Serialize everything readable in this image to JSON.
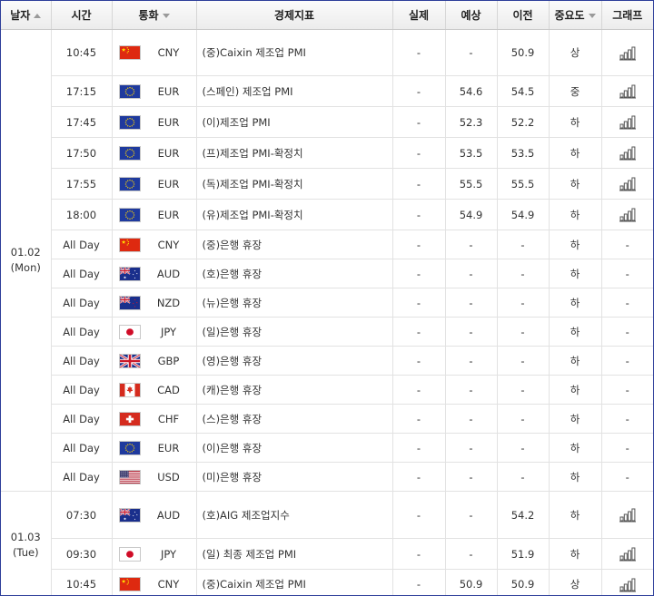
{
  "headers": [
    {
      "key": "date",
      "label": "날자",
      "sort": "up"
    },
    {
      "key": "time",
      "label": "시간",
      "sort": null
    },
    {
      "key": "currency",
      "label": "통화",
      "sort": "down"
    },
    {
      "key": "indicator",
      "label": "경제지표",
      "sort": null
    },
    {
      "key": "actual",
      "label": "실제",
      "sort": null
    },
    {
      "key": "forecast",
      "label": "예상",
      "sort": null
    },
    {
      "key": "previous",
      "label": "이전",
      "sort": null
    },
    {
      "key": "importance",
      "label": "중요도",
      "sort": "down"
    },
    {
      "key": "graph",
      "label": "그래프",
      "sort": null
    }
  ],
  "date_groups": [
    {
      "date": "01.02",
      "day": "(Mon)",
      "rows": [
        {
          "time": "10:45",
          "flag": "cn-flag-icon",
          "currency": "CNY",
          "indicator": "(중)Caixin 제조업 PMI",
          "actual": "-",
          "forecast": "-",
          "previous": "50.9",
          "importance": "상",
          "graph": true
        },
        {
          "time": "17:15",
          "flag": "eu-flag-icon",
          "currency": "EUR",
          "indicator": "(스페인) 제조업 PMI",
          "actual": "-",
          "forecast": "54.6",
          "previous": "54.5",
          "importance": "중",
          "graph": true
        },
        {
          "time": "17:45",
          "flag": "eu-flag-icon",
          "currency": "EUR",
          "indicator": "(이)제조업 PMI",
          "actual": "-",
          "forecast": "52.3",
          "previous": "52.2",
          "importance": "하",
          "graph": true
        },
        {
          "time": "17:50",
          "flag": "eu-flag-icon",
          "currency": "EUR",
          "indicator": "(프)제조업 PMI-확정치",
          "actual": "-",
          "forecast": "53.5",
          "previous": "53.5",
          "importance": "하",
          "graph": true
        },
        {
          "time": "17:55",
          "flag": "eu-flag-icon",
          "currency": "EUR",
          "indicator": "(독)제조업 PMI-확정치",
          "actual": "-",
          "forecast": "55.5",
          "previous": "55.5",
          "importance": "하",
          "graph": true
        },
        {
          "time": "18:00",
          "flag": "eu-flag-icon",
          "currency": "EUR",
          "indicator": "(유)제조업 PMI-확정치",
          "actual": "-",
          "forecast": "54.9",
          "previous": "54.9",
          "importance": "하",
          "graph": true
        },
        {
          "time": "All Day",
          "flag": "cn-flag-icon",
          "currency": "CNY",
          "indicator": "(중)은행 휴장",
          "actual": "-",
          "forecast": "-",
          "previous": "-",
          "importance": "하",
          "graph": false
        },
        {
          "time": "All Day",
          "flag": "au-flag-icon",
          "currency": "AUD",
          "indicator": "(호)은행 휴장",
          "actual": "-",
          "forecast": "-",
          "previous": "-",
          "importance": "하",
          "graph": false
        },
        {
          "time": "All Day",
          "flag": "nz-flag-icon",
          "currency": "NZD",
          "indicator": "(뉴)은행 휴장",
          "actual": "-",
          "forecast": "-",
          "previous": "-",
          "importance": "하",
          "graph": false
        },
        {
          "time": "All Day",
          "flag": "jp-flag-icon",
          "currency": "JPY",
          "indicator": "(일)은행 휴장",
          "actual": "-",
          "forecast": "-",
          "previous": "-",
          "importance": "하",
          "graph": false
        },
        {
          "time": "All Day",
          "flag": "gb-flag-icon",
          "currency": "GBP",
          "indicator": "(영)은행 휴장",
          "actual": "-",
          "forecast": "-",
          "previous": "-",
          "importance": "하",
          "graph": false
        },
        {
          "time": "All Day",
          "flag": "ca-flag-icon",
          "currency": "CAD",
          "indicator": "(캐)은행 휴장",
          "actual": "-",
          "forecast": "-",
          "previous": "-",
          "importance": "하",
          "graph": false
        },
        {
          "time": "All Day",
          "flag": "ch-flag-icon",
          "currency": "CHF",
          "indicator": "(스)은행 휴장",
          "actual": "-",
          "forecast": "-",
          "previous": "-",
          "importance": "하",
          "graph": false
        },
        {
          "time": "All Day",
          "flag": "eu-flag-icon",
          "currency": "EUR",
          "indicator": "(이)은행 휴장",
          "actual": "-",
          "forecast": "-",
          "previous": "-",
          "importance": "하",
          "graph": false
        },
        {
          "time": "All Day",
          "flag": "us-flag-icon",
          "currency": "USD",
          "indicator": "(미)은행 휴장",
          "actual": "-",
          "forecast": "-",
          "previous": "-",
          "importance": "하",
          "graph": false
        }
      ]
    },
    {
      "date": "01.03",
      "day": "(Tue)",
      "rows": [
        {
          "time": "07:30",
          "flag": "au-flag-icon",
          "currency": "AUD",
          "indicator": "(호)AIG 제조업지수",
          "actual": "-",
          "forecast": "-",
          "previous": "54.2",
          "importance": "하",
          "graph": true
        },
        {
          "time": "09:30",
          "flag": "jp-flag-icon",
          "currency": "JPY",
          "indicator": "(일) 최종 제조업 PMI",
          "actual": "-",
          "forecast": "-",
          "previous": "51.9",
          "importance": "하",
          "graph": true
        },
        {
          "time": "10:45",
          "flag": "cn-flag-icon",
          "currency": "CNY",
          "indicator": "(중)Caixin 제조업 PMI",
          "actual": "-",
          "forecast": "50.9",
          "previous": "50.9",
          "importance": "상",
          "graph": true
        }
      ]
    }
  ],
  "no_graph_text": "-",
  "colors": {
    "border": "#2d3e9a",
    "header_bg": "#f0f0f0",
    "grid": "#e2e2e2",
    "graph_icon": "#555555"
  }
}
